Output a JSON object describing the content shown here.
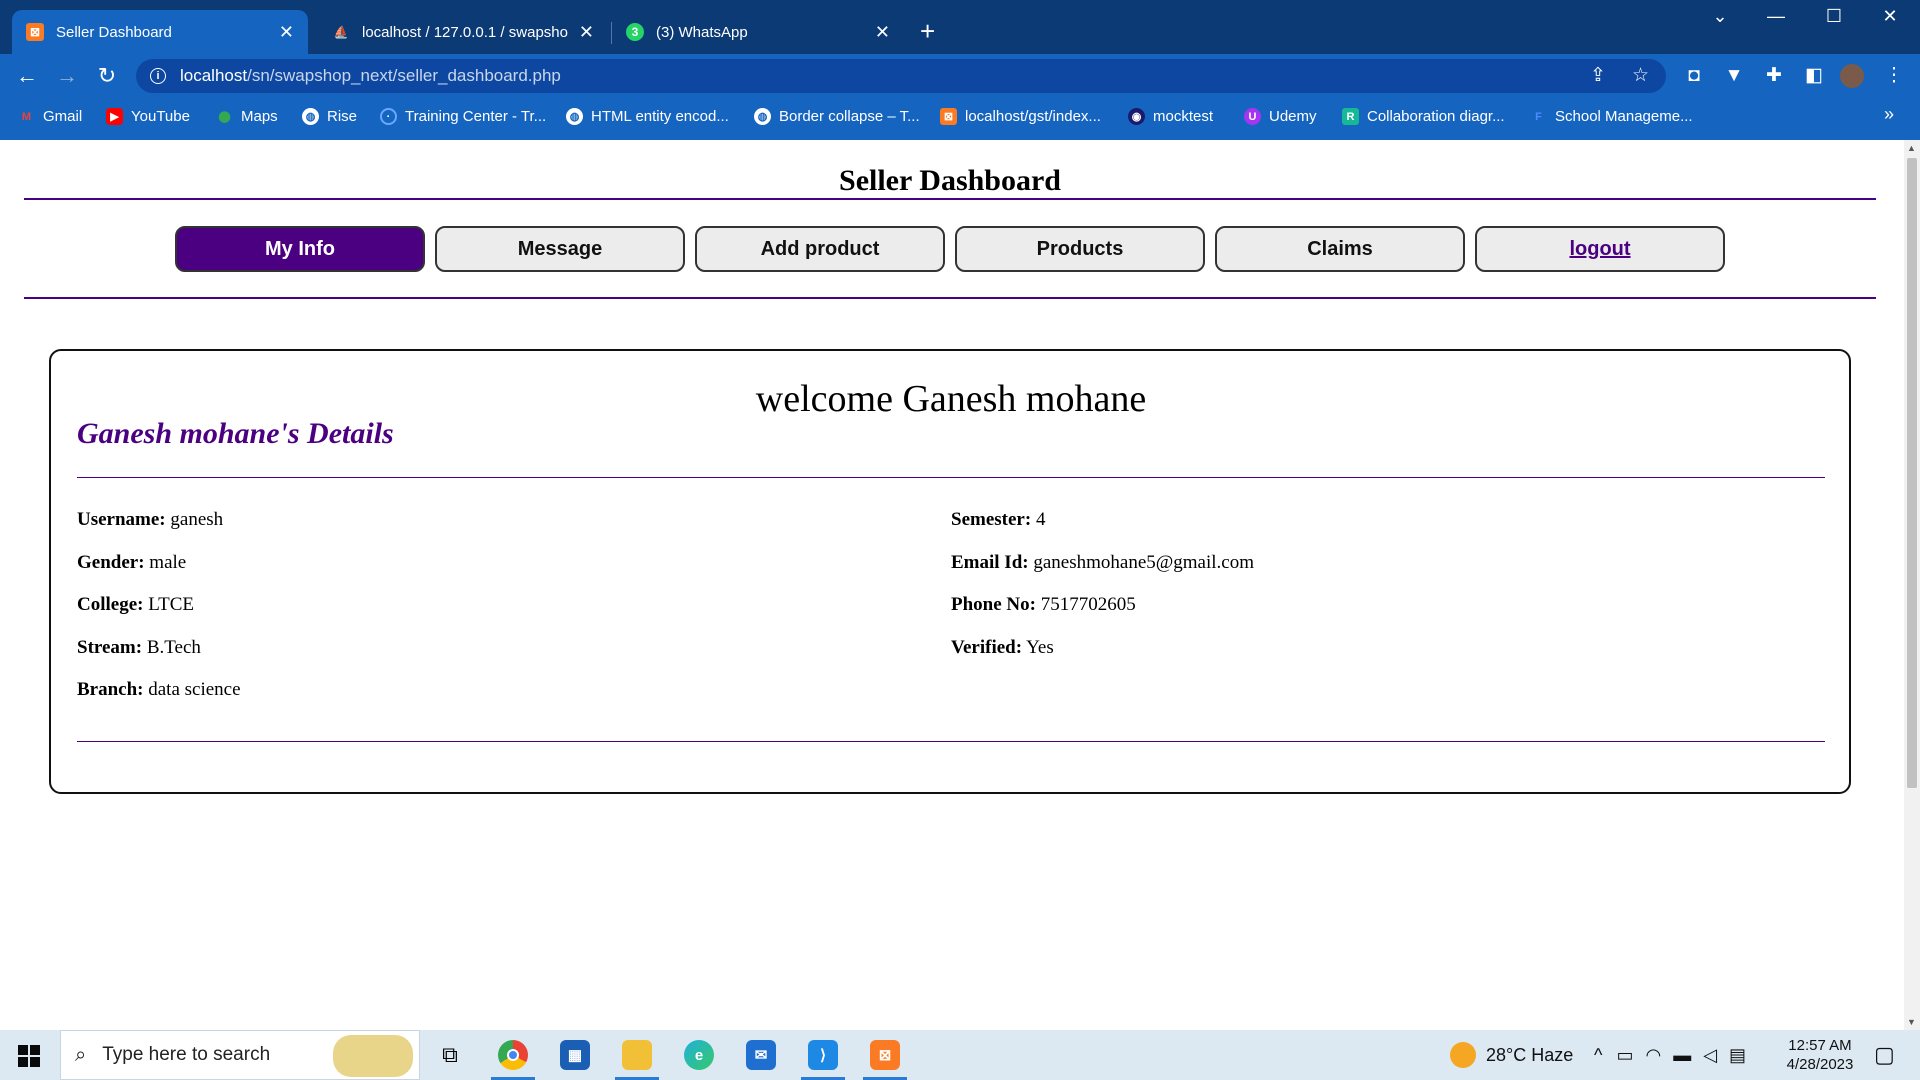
{
  "browser": {
    "tabs": [
      {
        "label": "Seller Dashboard",
        "active": true
      },
      {
        "label": "localhost / 127.0.0.1 / swapshop_",
        "active": false
      },
      {
        "label": "(3) WhatsApp",
        "active": false
      }
    ],
    "url_host": "localhost",
    "url_path": "/sn/swapshop_next/seller_dashboard.php",
    "bookmarks": [
      "Gmail",
      "YouTube",
      "Maps",
      "Rise",
      "Training Center - Tr...",
      "HTML entity encod...",
      "Border collapse – T...",
      "localhost/gst/index...",
      "mocktest",
      "Udemy",
      "Collaboration diagr...",
      "School Manageme..."
    ],
    "bookmarks_more": "»"
  },
  "page": {
    "title": "Seller Dashboard",
    "nav": [
      {
        "label": "My Info",
        "active": true
      },
      {
        "label": "Message"
      },
      {
        "label": "Add product"
      },
      {
        "label": "Products"
      },
      {
        "label": "Claims"
      },
      {
        "label": "logout",
        "link": true
      }
    ],
    "welcome": "welcome Ganesh mohane",
    "details_heading": "Ganesh mohane's Details",
    "left_fields": [
      {
        "label": "Username:",
        "value": "ganesh"
      },
      {
        "label": "Gender:",
        "value": "male"
      },
      {
        "label": "College:",
        "value": "LTCE"
      },
      {
        "label": "Stream:",
        "value": "B.Tech"
      },
      {
        "label": "Branch:",
        "value": "data science"
      }
    ],
    "right_fields": [
      {
        "label": "Semester:",
        "value": "4"
      },
      {
        "label": "Email Id:",
        "value": "ganeshmohane5@gmail.com"
      },
      {
        "label": "Phone No:",
        "value": "7517702605"
      },
      {
        "label": "Verified:",
        "value": "Yes"
      }
    ]
  },
  "taskbar": {
    "search_placeholder": "Type here to search",
    "weather": "28°C  Haze",
    "time": "12:57 AM",
    "date": "4/28/2023"
  },
  "colors": {
    "accent": "#4b0082",
    "chrome": "#0c3a75",
    "toolbar": "#1565c0"
  }
}
